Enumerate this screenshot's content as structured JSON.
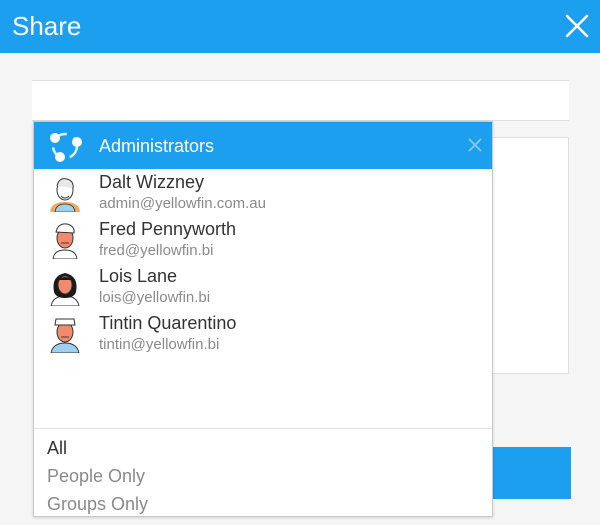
{
  "header": {
    "title": "Share",
    "close_icon": "close-icon"
  },
  "colors": {
    "accent": "#1d9ff0",
    "text": "#333333",
    "muted": "#8a8a8a"
  },
  "dropdown": {
    "selected_group": {
      "label": "Administrators",
      "icon": "group-share-icon",
      "remove_icon": "close-icon"
    },
    "users": [
      {
        "name": "Dalt Wizzney",
        "email": "admin@yellowfin.com.au",
        "avatar": "avatar-icon"
      },
      {
        "name": "Fred Pennyworth",
        "email": "fred@yellowfin.bi",
        "avatar": "avatar-icon"
      },
      {
        "name": "Lois Lane",
        "email": "lois@yellowfin.bi",
        "avatar": "avatar-icon"
      },
      {
        "name": "Tintin Quarentino",
        "email": "tintin@yellowfin.bi",
        "avatar": "avatar-icon"
      }
    ],
    "filters": [
      {
        "label": "All",
        "active": true
      },
      {
        "label": "People Only",
        "active": false
      },
      {
        "label": "Groups Only",
        "active": false
      }
    ]
  }
}
